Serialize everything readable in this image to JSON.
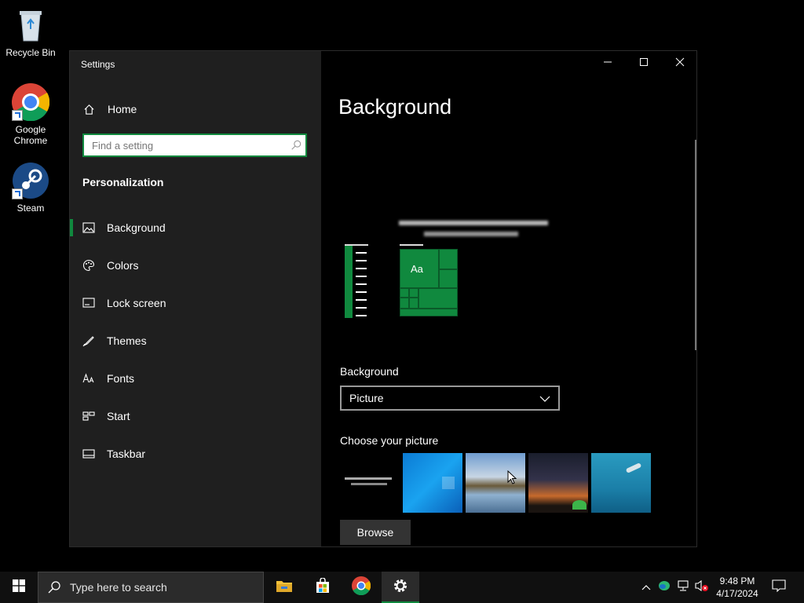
{
  "desktop": {
    "icons": [
      {
        "label": "Recycle Bin"
      },
      {
        "label": "Google Chrome"
      },
      {
        "label": "Steam"
      }
    ]
  },
  "window": {
    "title": "Settings",
    "controls": {
      "minimize": "minimize-icon",
      "maximize": "maximize-icon",
      "close": "close-icon"
    }
  },
  "sidebar": {
    "home_label": "Home",
    "search_placeholder": "Find a setting",
    "section_title": "Personalization",
    "items": [
      {
        "label": "Background",
        "icon": "picture-icon",
        "active": true
      },
      {
        "label": "Colors",
        "icon": "palette-icon"
      },
      {
        "label": "Lock screen",
        "icon": "lock-screen-icon"
      },
      {
        "label": "Themes",
        "icon": "brush-icon"
      },
      {
        "label": "Fonts",
        "icon": "font-icon"
      },
      {
        "label": "Start",
        "icon": "start-icon"
      },
      {
        "label": "Taskbar",
        "icon": "taskbar-icon"
      }
    ]
  },
  "content": {
    "title": "Background",
    "preview": {
      "tile_text": "Aa"
    },
    "background_label": "Background",
    "background_value": "Picture",
    "choose_label": "Choose your picture",
    "browse_label": "Browse"
  },
  "taskbar": {
    "search_placeholder": "Type here to search",
    "apps": [
      "file-explorer-icon",
      "microsoft-store-icon",
      "chrome-icon",
      "settings-icon"
    ],
    "time": "9:48 PM",
    "date": "4/17/2024"
  },
  "colors": {
    "accent": "#10893e",
    "sidebar": "#1f1f1f",
    "taskbar": "#101010"
  }
}
